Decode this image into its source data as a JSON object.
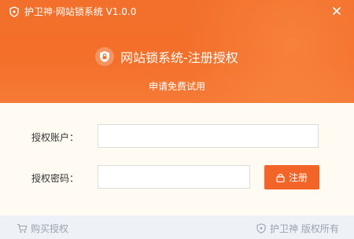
{
  "titlebar": {
    "title": "护卫神·网站锁系统 V1.0.0",
    "logo_icon": "shield-logo-icon",
    "close_icon": "close-icon"
  },
  "header": {
    "title": "网站锁系统-注册授权",
    "subtitle": "申请免费试用",
    "icon": "shield-lock-icon"
  },
  "form": {
    "account_label": "授权账户：",
    "account_value": "",
    "password_label": "授权密码：",
    "password_value": "",
    "register_label": "注册",
    "register_icon": "lock-icon"
  },
  "footer": {
    "buy_label": "购买授权",
    "buy_icon": "cart-icon",
    "copyright_label": "护卫神 版权所有",
    "copyright_icon": "shield-logo-icon"
  },
  "colors": {
    "accent": "#f36429",
    "header": "#f2702b",
    "footer_bg": "#eef2f7",
    "footer_text": "#9aa3ad"
  }
}
